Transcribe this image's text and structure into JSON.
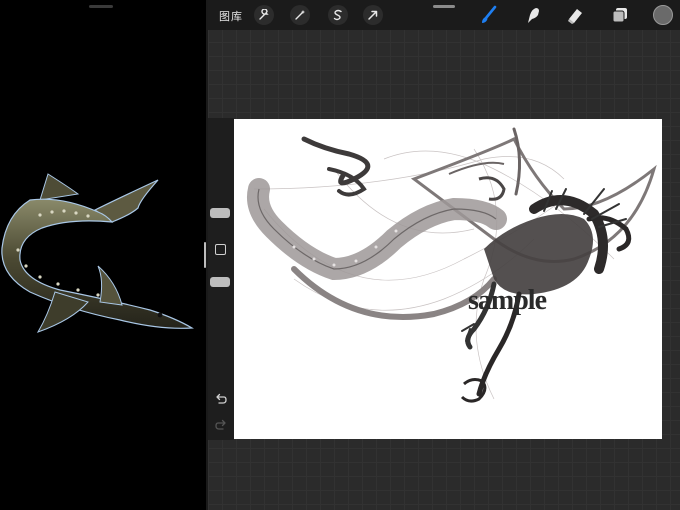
{
  "left_pane": {
    "reference_image": "sturgeon-fish-photo"
  },
  "top_bar": {
    "gallery_label": "图库",
    "actions_icon": "wrench-icon",
    "adjustments_icon": "magic-wand-icon",
    "selection_icon": "selection-s-icon",
    "transform_icon": "arrow-cursor-icon",
    "brush_icon": "brush-icon",
    "smudge_icon": "smudge-icon",
    "eraser_icon": "eraser-icon",
    "layers_icon": "layers-icon",
    "accent_color": "#1e7ff2",
    "current_color": "#6a6a6a"
  },
  "sidebar": {
    "undo_icon": "undo-icon",
    "redo_icon": "redo-icon"
  },
  "canvas": {
    "watermark": "sample"
  }
}
